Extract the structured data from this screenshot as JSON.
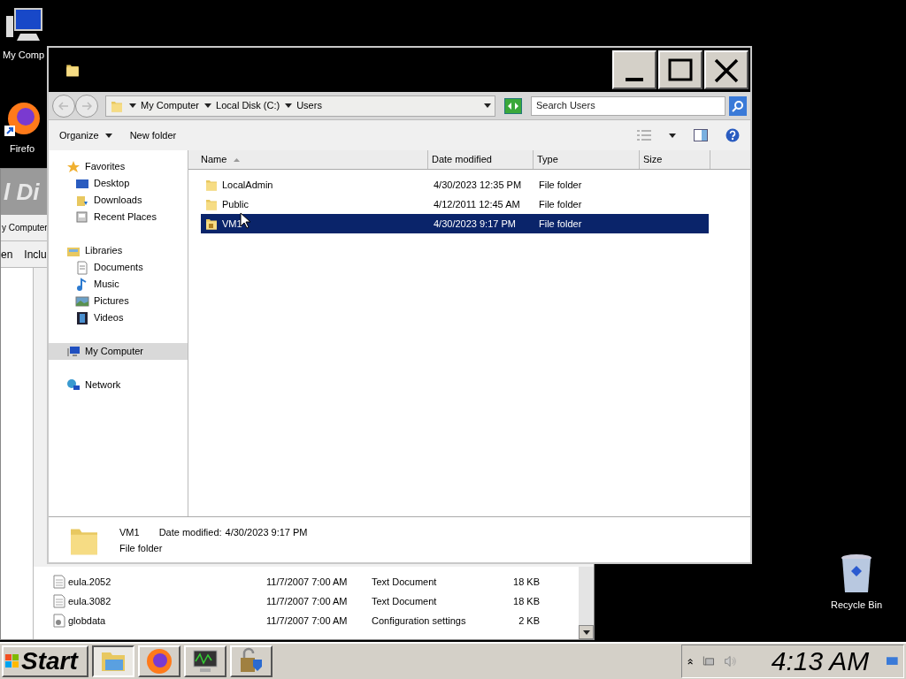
{
  "desktop_icons": [
    {
      "kind": "computer",
      "label": "My Comp"
    },
    {
      "kind": "firefox",
      "label": "Firefo"
    },
    {
      "kind": "recycle-bin",
      "label": "Recycle Bin"
    }
  ],
  "background_window": {
    "heading": "l Di",
    "breadcrumb": "y Computer",
    "toolbar": [
      "en",
      "Inclu"
    ],
    "rows": [
      {
        "kind": "text",
        "name": "eula.2052",
        "date": "11/7/2007 7:00 AM",
        "type": "Text Document",
        "size": "18 KB"
      },
      {
        "kind": "text",
        "name": "eula.3082",
        "date": "11/7/2007 7:00 AM",
        "type": "Text Document",
        "size": "18 KB"
      },
      {
        "kind": "settings",
        "name": "globdata",
        "date": "11/7/2007 7:00 AM",
        "type": "Configuration settings",
        "size": "2 KB"
      }
    ]
  },
  "window": {
    "address": [
      "My Computer",
      "Local Disk (C:)",
      "Users"
    ],
    "search": {
      "placeholder": "Search Users"
    },
    "toolbar": [
      {
        "kind": "menu",
        "label": "Organize"
      },
      {
        "kind": "button",
        "label": "New folder"
      }
    ],
    "nav": [
      {
        "kind": "favorites",
        "label": "Favorites",
        "selected": false,
        "children": [
          {
            "kind": "desktop",
            "label": "Desktop",
            "selected": false
          },
          {
            "kind": "downloads",
            "label": "Downloads",
            "selected": false
          },
          {
            "kind": "recent",
            "label": "Recent Places",
            "selected": false
          }
        ]
      },
      {
        "kind": "libraries",
        "label": "Libraries",
        "selected": false,
        "children": [
          {
            "kind": "documents",
            "label": "Documents",
            "selected": false
          },
          {
            "kind": "music",
            "label": "Music",
            "selected": false
          },
          {
            "kind": "pictures",
            "label": "Pictures",
            "selected": false
          },
          {
            "kind": "videos",
            "label": "Videos",
            "selected": false
          }
        ]
      },
      {
        "kind": "computer",
        "label": "My Computer",
        "selected": true
      },
      {
        "kind": "network",
        "label": "Network",
        "selected": false
      }
    ],
    "columns": [
      {
        "label": "Name",
        "sorted": true
      },
      {
        "label": "Date modified",
        "sorted": false
      },
      {
        "label": "Type",
        "sorted": false
      },
      {
        "label": "Size",
        "sorted": false
      }
    ],
    "rows": [
      {
        "name": "LocalAdmin",
        "date": "4/30/2023 12:35 PM",
        "type": "File folder",
        "locked": false,
        "selected": false
      },
      {
        "name": "Public",
        "date": "4/12/2011 12:45 AM",
        "type": "File folder",
        "locked": false,
        "selected": false
      },
      {
        "name": "VM1",
        "date": "4/30/2023 9:17 PM",
        "type": "File folder",
        "locked": true,
        "selected": true
      }
    ],
    "details": {
      "name": "VM1",
      "date_label": "Date modified:",
      "date": "4/30/2023 9:17 PM",
      "type": "File folder"
    }
  },
  "taskbar": {
    "start": "Start",
    "buttons": [
      {
        "kind": "explorer",
        "active": true
      },
      {
        "kind": "firefox",
        "active": false
      },
      {
        "kind": "monitor",
        "active": false
      },
      {
        "kind": "security",
        "active": false
      }
    ],
    "clock": "4:13 AM"
  }
}
